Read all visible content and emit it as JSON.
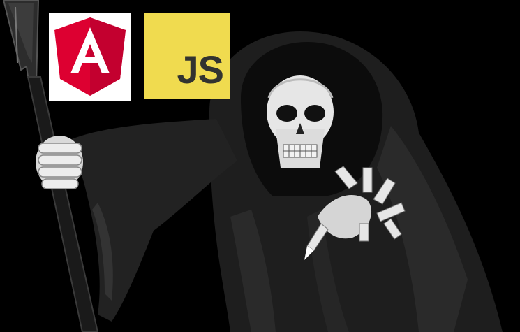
{
  "logos": {
    "angular": {
      "name": "angular-logo",
      "letter": "A",
      "primary": "#dd0031",
      "secondary": "#c3002f",
      "background": "#ffffff"
    },
    "javascript": {
      "name": "javascript-logo",
      "text": "JS",
      "background": "#f0db4f",
      "text_color": "#323330"
    }
  },
  "illustration": {
    "subject": "grim-reaper-icon",
    "colors": {
      "robe": "#1e1e1e",
      "robe_shadow": "#0c0c0c",
      "robe_highlight": "#3a3a3a",
      "bone": "#e6e6e6",
      "bone_shadow": "#9a9a9a",
      "pole": "#1a1a1a"
    }
  }
}
